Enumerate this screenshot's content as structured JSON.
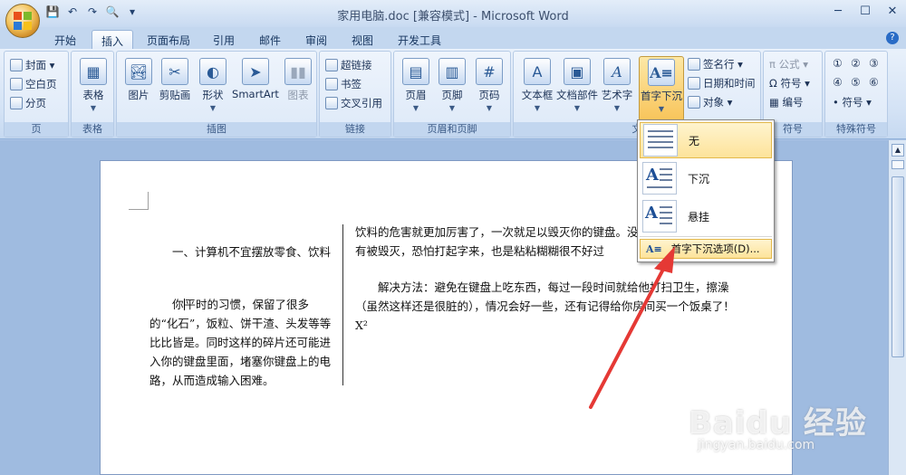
{
  "window": {
    "title": "家用电脑.doc [兼容模式] - Microsoft Word",
    "qat": [
      "💾",
      "↶",
      "↷",
      "🔍",
      "▾"
    ],
    "controls": [
      "─",
      "☐",
      "✕"
    ]
  },
  "tabs": [
    "开始",
    "插入",
    "页面布局",
    "引用",
    "邮件",
    "审阅",
    "视图",
    "开发工具"
  ],
  "active_tab": "插入",
  "ribbon": {
    "pages": {
      "items": [
        "封面 ▾",
        "空白页",
        "分页"
      ],
      "label": "页"
    },
    "tables": {
      "button": "表格",
      "label": "表格"
    },
    "illustrations": {
      "buttons": [
        "图片",
        "剪贴画",
        "形状",
        "SmartArt",
        "图表"
      ],
      "label": "插图"
    },
    "links": {
      "items": [
        "超链接",
        "书签",
        "交叉引用"
      ],
      "label": "链接"
    },
    "header_footer": {
      "buttons": [
        "页眉",
        "页脚",
        "页码"
      ],
      "label": "页眉和页脚"
    },
    "text": {
      "buttons": [
        "文本框",
        "文档部件",
        "艺术字",
        "首字下沉"
      ],
      "small": [
        "签名行 ▾",
        "日期和时间",
        "对象 ▾"
      ],
      "label": "文"
    },
    "symbols": {
      "items": [
        "π 公式 ▾",
        "Ω 符号 ▾",
        "▦ 编号"
      ],
      "label": "符号"
    },
    "special": {
      "row1": [
        "①",
        "②",
        "③"
      ],
      "row2": [
        "④",
        "⑤",
        "⑥"
      ],
      "item": "• 符号 ▾",
      "label": "特殊符号"
    }
  },
  "dropcap_menu": {
    "items": [
      "无",
      "下沉",
      "悬挂"
    ],
    "options_label": "首字下沉选项(D)..."
  },
  "document": {
    "col1_heading": "一、计算机不宜摆放零食、饮料",
    "col1_para_before_cursor": "你",
    "col1_para_after_cursor": "平时的习惯，保留了很多的“化石”，饭粒、饼干渣、头发等等比比皆是。同时这样的碎片还可能进入你的键盘里面，堵塞你键盘上的电路，从而造成输入困难。",
    "col2_para1": "饮料的危害就更加厉害了，一次就足以毁灭你的键盘。没有被毁灭，恐怕打起字来，也是粘粘糊糊很不好过",
    "col2_para2": "解决方法：避免在键盘上吃东西，每过一段时间就给他打扫卫生，擦澡（虽然这样还是很脏的），情况会好一些，还有记得给你房间买一个饭桌了！X²"
  },
  "watermark": {
    "logo": "Baidu 经验",
    "url": "jingyan.baidu.com"
  },
  "colors": {
    "ribbon": "#d3e2f5",
    "doc_bg": "#9fbbe0",
    "highlight": "#fde39a",
    "arrow": "#e53935"
  }
}
